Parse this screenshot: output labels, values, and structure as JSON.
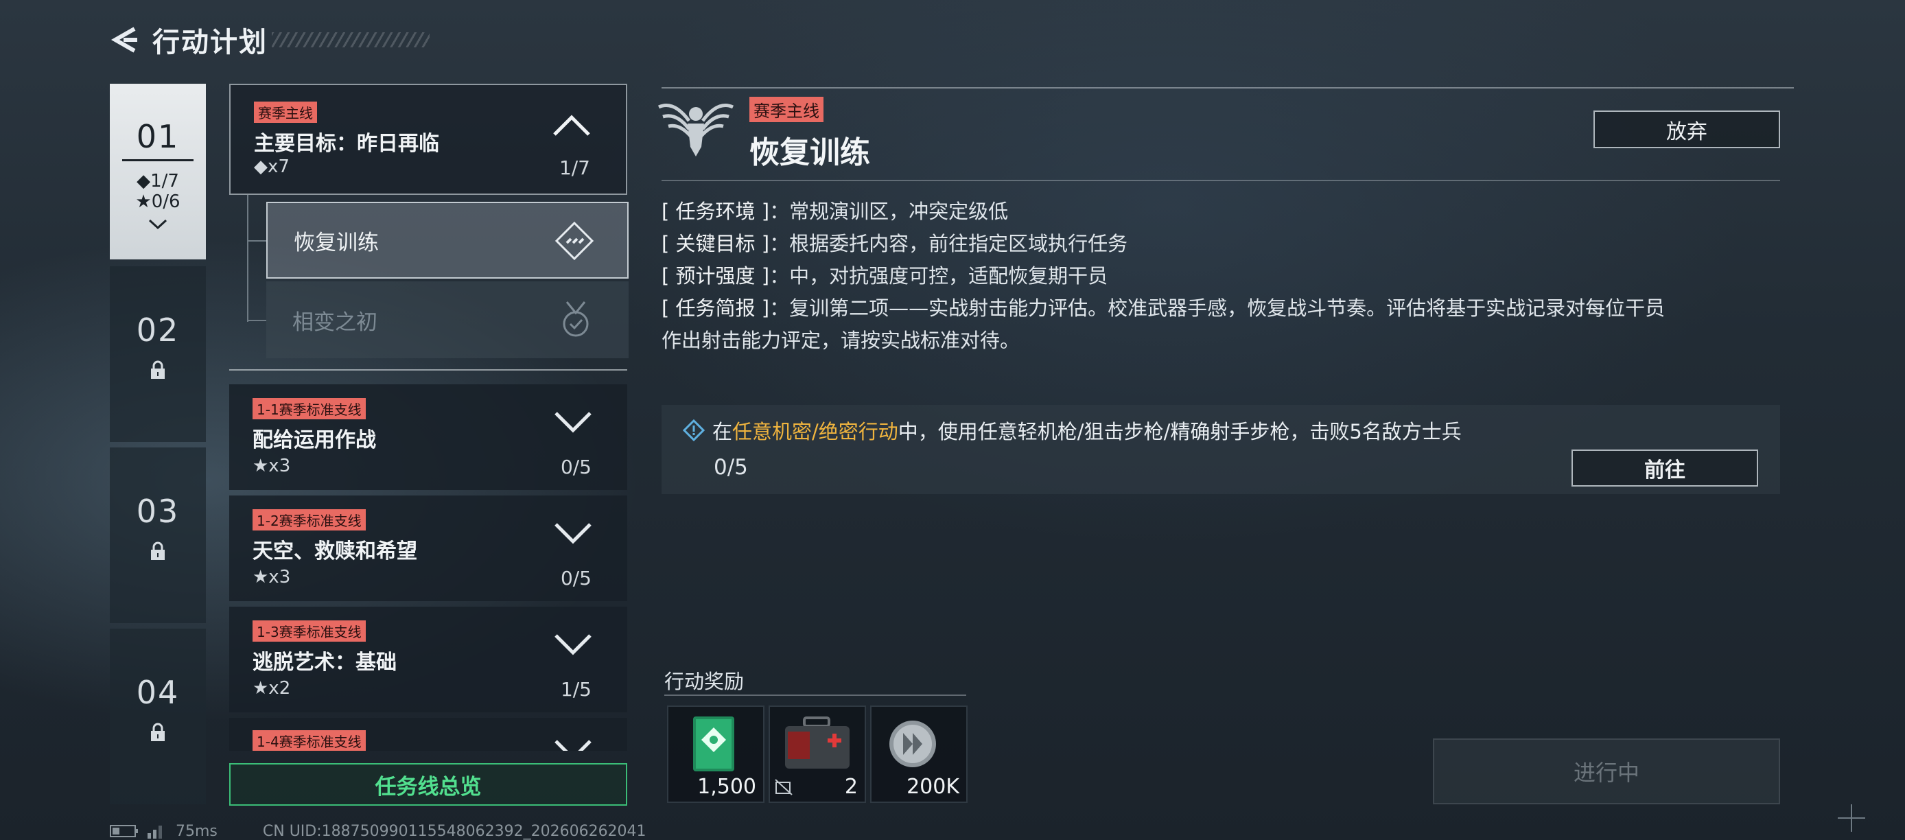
{
  "header": {
    "title": "行动计划"
  },
  "chapters": [
    {
      "num": "01",
      "stat_diamond": "◆1/7",
      "stat_star": "★0/6"
    },
    {
      "num": "02"
    },
    {
      "num": "03"
    },
    {
      "num": "04"
    }
  ],
  "main_quest": {
    "tag": "赛季主线",
    "name": "主要目标：昨日再临",
    "reward": "◆x7",
    "progress": "1/7"
  },
  "sub_quests": [
    {
      "name": "恢复训练"
    },
    {
      "name": "相变之初"
    }
  ],
  "quests": [
    {
      "tag": "1-1赛季标准支线",
      "name": "配给运用作战",
      "reward": "★x3",
      "progress": "0/5"
    },
    {
      "tag": "1-2赛季标准支线",
      "name": "天空、救赎和希望",
      "reward": "★x3",
      "progress": "0/5"
    },
    {
      "tag": "1-3赛季标准支线",
      "name": "逃脱艺术：基础",
      "reward": "★x2",
      "progress": "1/5"
    },
    {
      "tag": "1-4赛季标准支线"
    }
  ],
  "overview_button": "任务线总览",
  "detail": {
    "tag": "赛季主线",
    "title": "恢复训练",
    "abandon": "放弃",
    "info": [
      {
        "key": "[ 任务环境 ]",
        "value": "：常规演训区，冲突定级低"
      },
      {
        "key": "[ 关键目标 ]",
        "value": "：根据委托内容，前往指定区域执行任务"
      },
      {
        "key": "[ 预计强度 ]",
        "value": "：中，对抗强度可控，适配恢复期干员"
      },
      {
        "key": "[ 任务简报 ]",
        "value": "：复训第二项——实战射击能力评估。校准武器手感，恢复战斗节奏。评估将基于实战记录对每位干员"
      }
    ],
    "info_cont": "作出射击能力评定，请按实战标准对待。",
    "objective": {
      "pre": "在",
      "highlight": "任意机密/绝密行动",
      "post": "中，使用任意轻机枪/狙击步枪/精确射手步枪，击败5名敌方士兵",
      "progress": "0/5",
      "goto": "前往"
    },
    "rewards_label": "行动奖励",
    "rewards": [
      {
        "icon": "green-badge-icon",
        "amount": "1,500"
      },
      {
        "icon": "medkit-icon",
        "amount": "2"
      },
      {
        "icon": "silver-coin-icon",
        "amount": "200K"
      }
    ],
    "in_progress": "进行中"
  },
  "status_bar": {
    "ping": "75ms",
    "uid": "CN UID:18875099011554806​2392_202606262041"
  },
  "colors": {
    "accent_green": "#3bbd77",
    "tag_red": "#e86a62",
    "highlight_orange": "#f0b43e"
  }
}
